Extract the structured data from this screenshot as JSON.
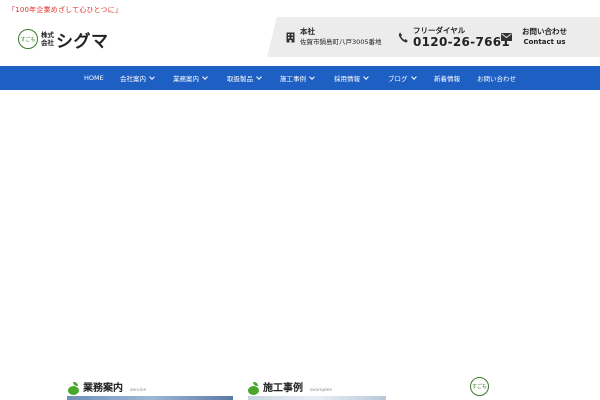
{
  "header": {
    "tagline": "「100年企業めざして心ひとつに」",
    "logo": {
      "mark_text": "すごも",
      "kabushiki_top": "株式",
      "kabushiki_bottom": "会社",
      "company_name": "シグマ"
    },
    "info": {
      "office": {
        "icon": "building-icon",
        "title": "本社",
        "address": "佐賀市鍋島町八戸3005番地"
      },
      "phone": {
        "icon": "phone-icon",
        "title": "フリーダイヤル",
        "number": "0120-26-7661"
      },
      "contact": {
        "icon": "mail-icon",
        "title": "お問い合わせ",
        "subtitle": "Contact us"
      }
    }
  },
  "nav": {
    "items": [
      {
        "label": "HOME",
        "has_dropdown": false
      },
      {
        "label": "会社案内",
        "has_dropdown": true
      },
      {
        "label": "業務案内",
        "has_dropdown": true
      },
      {
        "label": "取扱製品",
        "has_dropdown": true
      },
      {
        "label": "施工事例",
        "has_dropdown": true
      },
      {
        "label": "採用情報",
        "has_dropdown": true
      },
      {
        "label": "ブログ",
        "has_dropdown": true
      },
      {
        "label": "新着情報",
        "has_dropdown": false
      },
      {
        "label": "お問い合わせ",
        "has_dropdown": false
      }
    ]
  },
  "sections": {
    "service": {
      "title": "業務案内",
      "subtitle": "service"
    },
    "examples": {
      "title": "施工事例",
      "subtitle": "examples"
    },
    "badge_text": "すごも"
  },
  "colors": {
    "nav_bg": "#1e5fc4",
    "tagline": "#e0302a",
    "brand_green": "#49a82c",
    "info_bar_bg": "#ececec"
  }
}
